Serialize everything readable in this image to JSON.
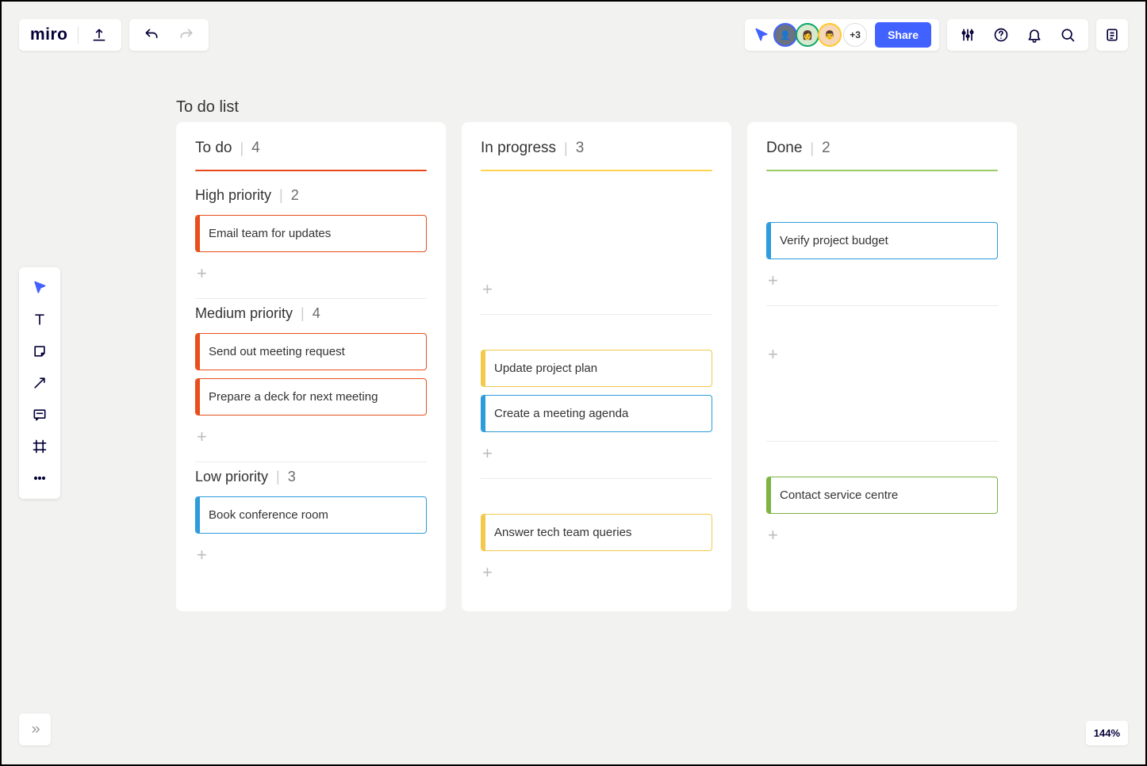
{
  "app_name": "miro",
  "board_title": "To do list",
  "header": {
    "share_label": "Share",
    "more_users": "+3"
  },
  "zoom": "144%",
  "columns": [
    {
      "title": "To do",
      "count": 4,
      "line": "line-red",
      "sections": [
        {
          "title": "High priority",
          "count": 2,
          "cards": [
            {
              "text": "Email team for updates",
              "color": "c-red"
            }
          ]
        },
        {
          "title": "Medium priority",
          "count": 4,
          "cards": [
            {
              "text": "Send out meeting request",
              "color": "c-red"
            },
            {
              "text": "Prepare a deck for next meeting",
              "color": "c-red"
            }
          ]
        },
        {
          "title": "Low priority",
          "count": 3,
          "cards": [
            {
              "text": "Book conference room",
              "color": "c-blue"
            }
          ]
        }
      ]
    },
    {
      "title": "In progress",
      "count": 3,
      "line": "line-yellow",
      "sections": [
        {
          "title": "",
          "count": null,
          "cards": [],
          "empty_high": true
        },
        {
          "title": "",
          "count": null,
          "cards": [
            {
              "text": "Update project plan",
              "color": "c-yellow"
            },
            {
              "text": "Create a meeting agenda",
              "color": "c-blue"
            }
          ]
        },
        {
          "title": "",
          "count": null,
          "cards": [
            {
              "text": "Answer tech team queries",
              "color": "c-yellow"
            }
          ]
        }
      ]
    },
    {
      "title": "Done",
      "count": 2,
      "line": "line-green",
      "sections": [
        {
          "title": "",
          "count": null,
          "cards": [
            {
              "text": "Verify project budget",
              "color": "c-blue"
            }
          ]
        },
        {
          "title": "",
          "count": null,
          "cards": [],
          "only_add": true
        },
        {
          "title": "",
          "count": null,
          "cards": [
            {
              "text": "Contact service centre",
              "color": "c-green"
            }
          ]
        }
      ]
    }
  ]
}
